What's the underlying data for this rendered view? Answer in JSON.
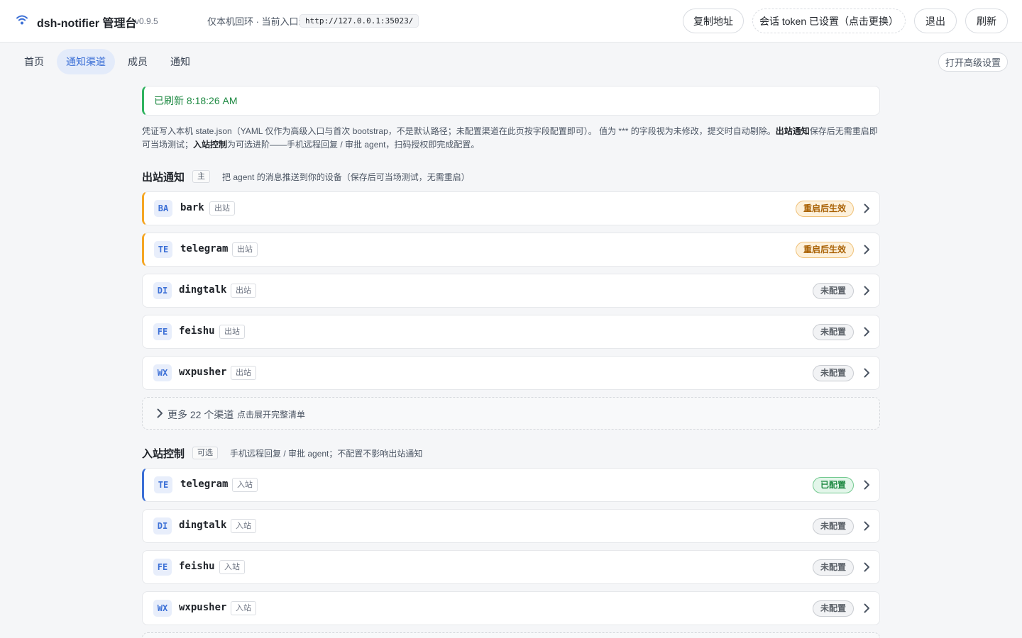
{
  "header": {
    "app_title": "dsh-notifier 管理台",
    "version": "v0.9.5",
    "entry_label": "仅本机回环 · 当前入口:",
    "entry_url": "http://127.0.0.1:35023/",
    "copy_address": "复制地址",
    "token_status": "会话 token 已设置（点击更换）",
    "logout": "退出",
    "refresh": "刷新"
  },
  "tabs": [
    {
      "label": "首页"
    },
    {
      "label": "通知渠道",
      "active": true
    },
    {
      "label": "成员"
    },
    {
      "label": "通知"
    }
  ],
  "advanced_settings": "打开高级设置",
  "notice": "已刷新 8:18:26 AM",
  "description": {
    "part1": "凭证写入本机 state.json（YAML 仅作为高级入口与首次 bootstrap，不是默认路径；未配置渠道在此页按字段配置即可）。 值为 *** 的字段视为未修改，提交时自动剔除。",
    "bold1": "出站通知",
    "part2": "保存后无需重启即可当场测试；",
    "bold2": "入站控制",
    "part3": "为可选进阶——手机远程回复 / 审批 agent，扫码授权即完成配置。"
  },
  "outbound": {
    "title": "出站通知",
    "badge": "主",
    "note": "把 agent 的消息推送到你的设备（保存后可当场测试，无需重启）",
    "channels": [
      {
        "abbr": "BA",
        "name": "bark",
        "tag": "出站",
        "status": "重启后生效",
        "state": "restart"
      },
      {
        "abbr": "TE",
        "name": "telegram",
        "tag": "出站",
        "status": "重启后生效",
        "state": "restart"
      },
      {
        "abbr": "DI",
        "name": "dingtalk",
        "tag": "出站",
        "status": "未配置",
        "state": "unset"
      },
      {
        "abbr": "FE",
        "name": "feishu",
        "tag": "出站",
        "status": "未配置",
        "state": "unset"
      },
      {
        "abbr": "WX",
        "name": "wxpusher",
        "tag": "出站",
        "status": "未配置",
        "state": "unset"
      }
    ],
    "more_label": "更多 22 个渠道",
    "more_hint": "点击展开完整清单"
  },
  "inbound": {
    "title": "入站控制",
    "badge": "可选",
    "note": "手机远程回复 / 审批 agent；不配置不影响出站通知",
    "channels": [
      {
        "abbr": "TE",
        "name": "telegram",
        "tag": "入站",
        "status": "已配置",
        "state": "ok"
      },
      {
        "abbr": "DI",
        "name": "dingtalk",
        "tag": "入站",
        "status": "未配置",
        "state": "unset"
      },
      {
        "abbr": "FE",
        "name": "feishu",
        "tag": "入站",
        "status": "未配置",
        "state": "unset"
      },
      {
        "abbr": "WX",
        "name": "wxpusher",
        "tag": "入站",
        "status": "未配置",
        "state": "unset"
      }
    ]
  },
  "colors": {
    "accent": "#3b6fd6",
    "success": "#2fb35f",
    "warning": "#f5a623"
  }
}
